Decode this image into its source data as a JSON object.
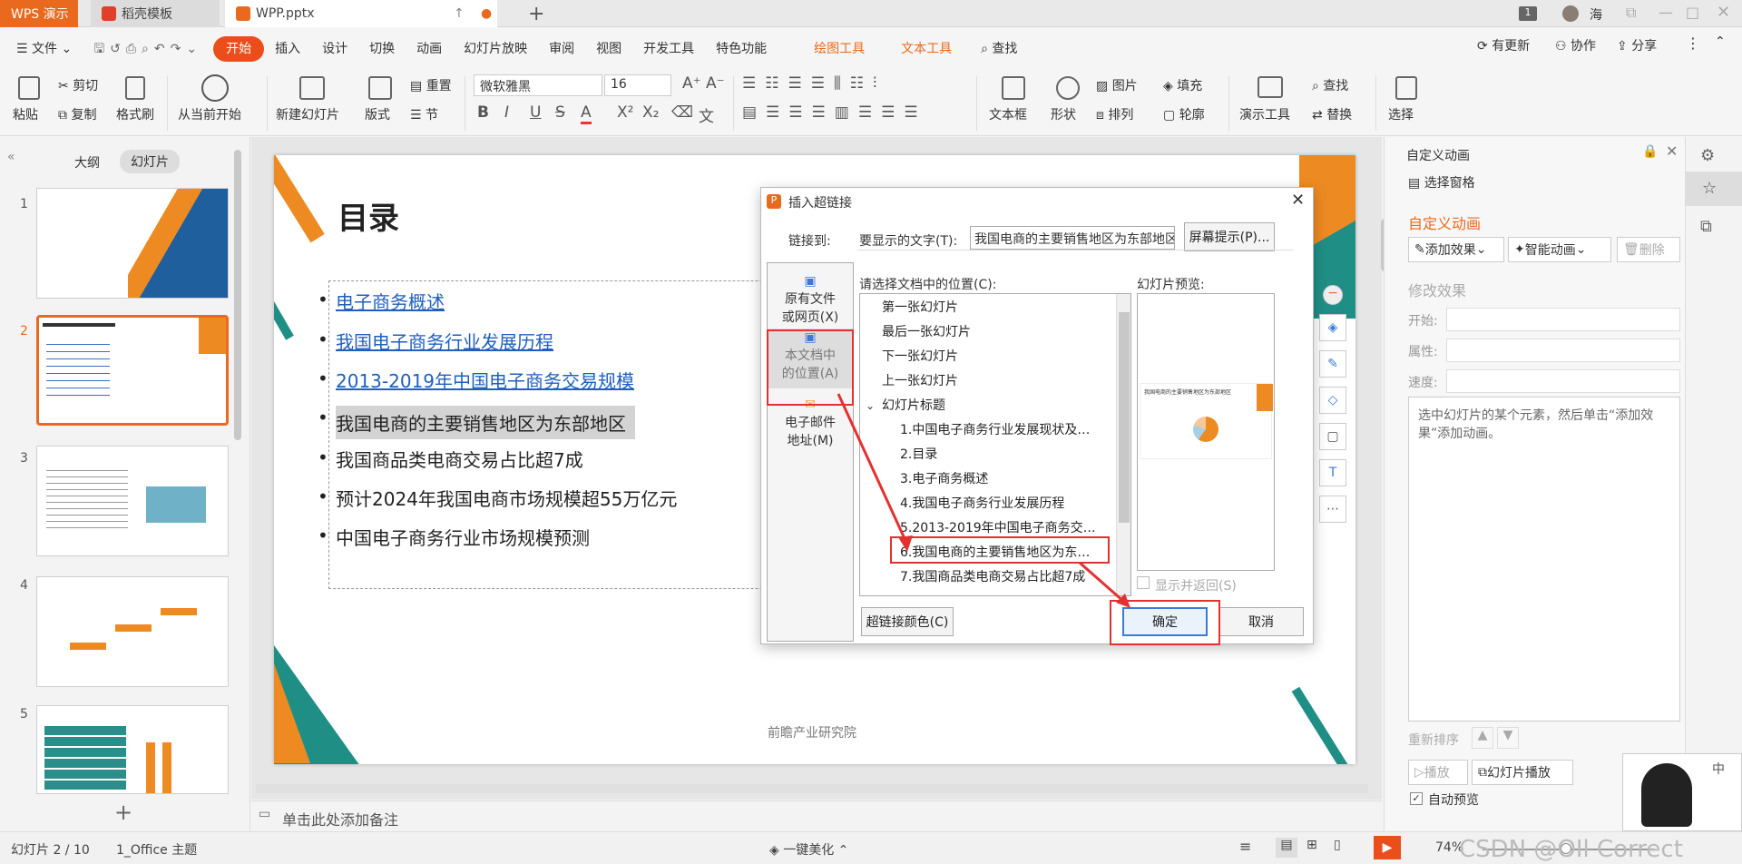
{
  "tabs": [
    {
      "label": "WPS 演示"
    },
    {
      "label": "稻壳模板"
    },
    {
      "label": "WPP.pptx"
    },
    {
      "label": "+"
    }
  ],
  "window": {
    "page_badge": "1",
    "user": "海"
  },
  "menu": {
    "file": "文件",
    "items": [
      "开始",
      "插入",
      "设计",
      "切换",
      "动画",
      "幻灯片放映",
      "审阅",
      "视图",
      "开发工具",
      "特色功能"
    ],
    "context": [
      "绘图工具",
      "文本工具"
    ],
    "search": "查找",
    "right": [
      "有更新",
      "协作",
      "分享"
    ]
  },
  "ribbon": {
    "paste": "粘贴",
    "cut": "剪切",
    "copy": "复制",
    "format_painter": "格式刷",
    "play_from_current": "从当前开始",
    "new_slide": "新建幻灯片",
    "layout": "版式",
    "reset": "重置",
    "section": "节",
    "font_name": "微软雅黑",
    "font_size": "16",
    "textbox": "文本框",
    "shape": "形状",
    "picture": "图片",
    "fill": "填充",
    "arrange": "排列",
    "outline": "轮廓",
    "presentation_tools": "演示工具",
    "find": "查找",
    "replace": "替换",
    "select": "选择"
  },
  "leftpanel": {
    "outline_tab": "大纲",
    "slides_tab": "幻灯片",
    "slide_numbers": [
      "1",
      "2",
      "3",
      "4",
      "5"
    ],
    "add": "+"
  },
  "slide": {
    "title": "目录",
    "bullets": [
      {
        "text": "电子商务概述",
        "link": true
      },
      {
        "text": "我国电子商务行业发展历程",
        "link": true
      },
      {
        "text": "2013-2019年中国电子商务交易规模",
        "link": true
      },
      {
        "text": "我国电商的主要销售地区为东部地区",
        "link": false,
        "highlight": true
      },
      {
        "text": "我国商品类电商交易占比超7成",
        "link": false
      },
      {
        "text": "预计2024年我国电商市场规模超55万亿元",
        "link": false
      },
      {
        "text": "中国电子商务行业市场规模预测",
        "link": false
      }
    ],
    "footer": "前瞻产业研究院"
  },
  "dialog": {
    "title": "插入超链接",
    "link_to": "链接到:",
    "display_text_label": "要显示的文字(T):",
    "display_text_value": "我国电商的主要销售地区为东部地区",
    "screen_tip": "屏幕提示(P)...",
    "place_label": "请选择文档中的位置(C):",
    "preview_label": "幻灯片预览:",
    "side_options": [
      "原有文件\n或网页(X)",
      "本文档中\n的位置(A)",
      "电子邮件\n地址(M)"
    ],
    "locations": [
      "第一张幻灯片",
      "最后一张幻灯片",
      "下一张幻灯片",
      "上一张幻灯片",
      "幻灯片标题",
      "1.中国电子商务行业发展现状及…",
      "2.目录",
      "3.电子商务概述",
      "4.我国电子商务行业发展历程",
      "5.2013-2019年中国电子商务交…",
      "6.我国电商的主要销售地区为东…",
      "7.我国商品类电商交易占比超7成"
    ],
    "show_and_return": "显示并返回(S)",
    "hyperlink_color": "超链接颜色(C)",
    "ok": "确定",
    "cancel": "取消",
    "preview_title": "我国电商的主要销售地区为东部地区"
  },
  "rightpanel": {
    "title": "自定义动画",
    "selection_pane": "选择窗格",
    "section_title": "自定义动画",
    "add_effect": "添加效果",
    "smart_animation": "智能动画",
    "delete": "删除",
    "modify": "修改效果",
    "start": "开始:",
    "property": "属性:",
    "speed": "速度:",
    "hint": "选中幻灯片的某个元素，然后单击“添加效果”添加动画。",
    "reorder": "重新排序",
    "play": "播放",
    "slideshow": "幻灯片播放",
    "auto_preview": "自动预览"
  },
  "notes": {
    "placeholder": "单击此处添加备注"
  },
  "status": {
    "slide": "幻灯片 2 / 10",
    "theme": "1_Office 主题",
    "beautify": "一键美化",
    "zoom": "74%",
    "watermark": "CSDN @OIl Correct"
  },
  "colors": {
    "accent": "#e94e1b",
    "orange": "#ee8a22",
    "teal": "#1f8f86",
    "red": "#e53030"
  }
}
